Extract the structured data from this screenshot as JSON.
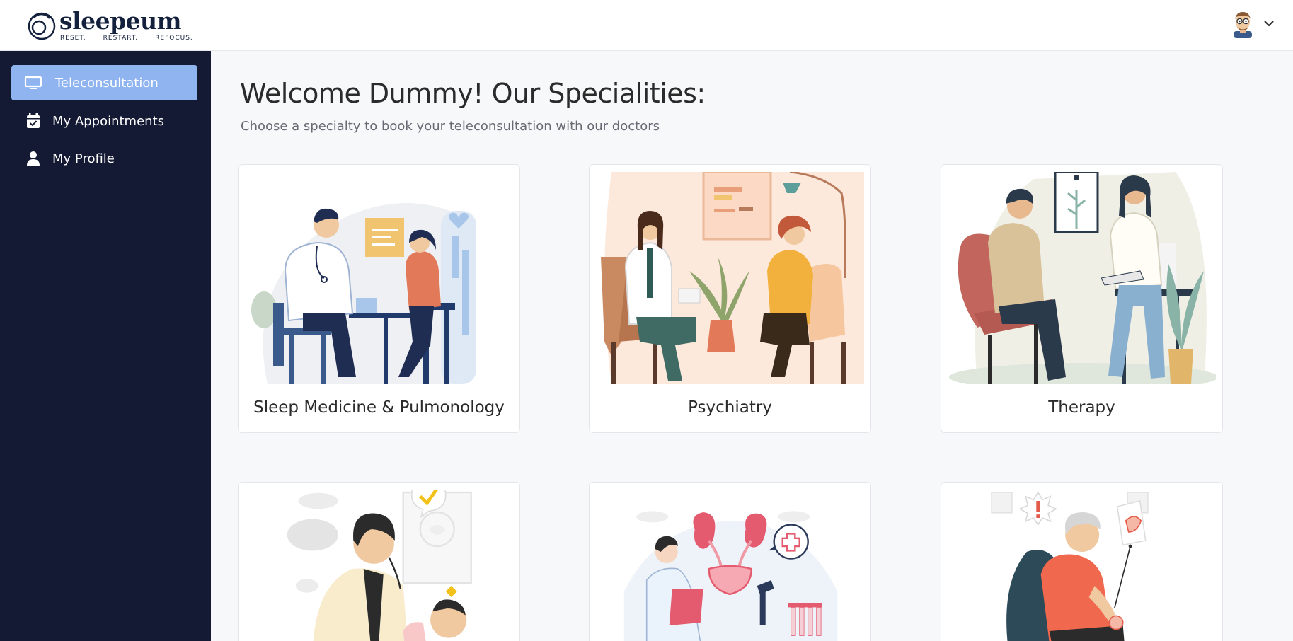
{
  "brand": {
    "name": "sleepeum",
    "tagline": [
      "RESET.",
      "RESTART.",
      "REFOCUS."
    ],
    "color": "#14213d"
  },
  "header": {
    "user_menu_icon": "chevron-down-icon",
    "avatar_icon": "user-avatar"
  },
  "sidebar": {
    "background": "#141a33",
    "active_color": "#8fb4f0",
    "items": [
      {
        "label": "Teleconsultation",
        "icon": "monitor-icon",
        "active": true
      },
      {
        "label": "My Appointments",
        "icon": "calendar-check-icon",
        "active": false
      },
      {
        "label": "My Profile",
        "icon": "user-icon",
        "active": false
      }
    ]
  },
  "main": {
    "title": "Welcome Dummy! Our Specialities:",
    "subtitle": "Choose a specialty to book your teleconsultation with our doctors",
    "specialties": [
      {
        "label": "Sleep Medicine & Pulmonology"
      },
      {
        "label": "Psychiatry"
      },
      {
        "label": "Therapy"
      },
      {
        "label": ""
      },
      {
        "label": ""
      },
      {
        "label": ""
      }
    ]
  }
}
